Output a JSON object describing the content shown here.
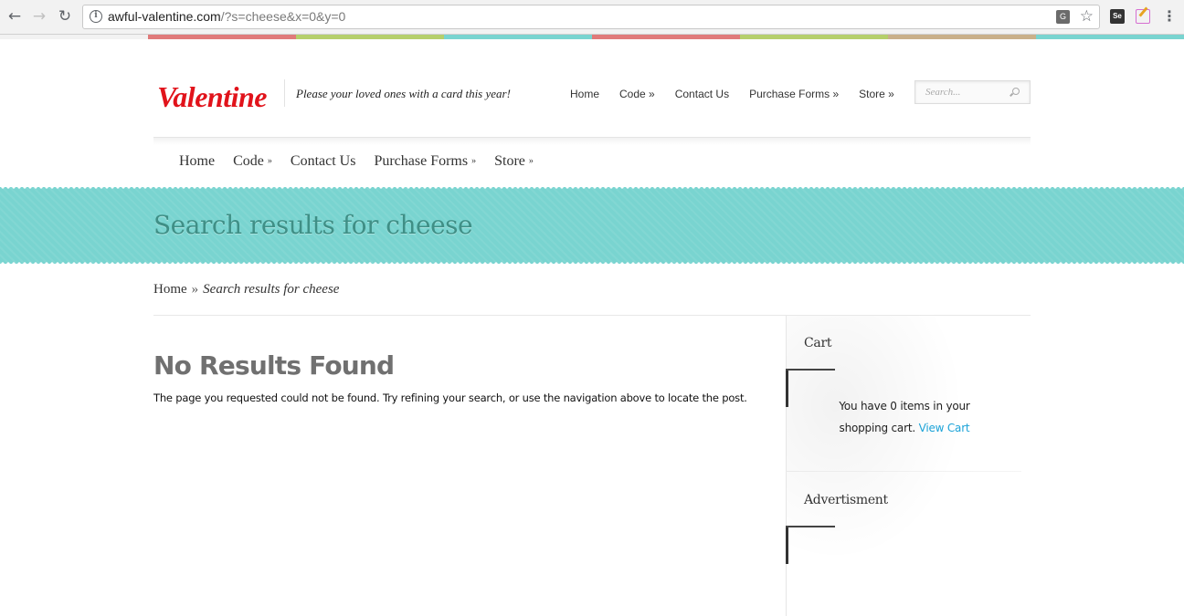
{
  "browser": {
    "url_host": "awful-valentine.com",
    "url_rest": "/?s=cheese&x=0&y=0",
    "extensions": {
      "se_label": "Se"
    }
  },
  "colors": {
    "strip": [
      "#f2f2f2",
      "#e07a7a",
      "#b5cf6b",
      "#79d4d0",
      "#e07a7a",
      "#b5cf6b",
      "#c9b08a",
      "#79d4d0"
    ],
    "accent_teal": "#79d4d0",
    "logo_red": "#e1131b",
    "link_blue": "#1ca3d8"
  },
  "header": {
    "logo": "Valentine",
    "tagline": "Please your loved ones with a card this year!",
    "top_nav": [
      "Home",
      "Code »",
      "Contact Us",
      "Purchase Forms »",
      "Store »"
    ],
    "search_placeholder": "Search..."
  },
  "main_nav": {
    "items": [
      {
        "label": "Home",
        "has_submenu": false
      },
      {
        "label": "Code",
        "has_submenu": true
      },
      {
        "label": "Contact Us",
        "has_submenu": false
      },
      {
        "label": "Purchase Forms",
        "has_submenu": true
      },
      {
        "label": "Store",
        "has_submenu": true
      }
    ],
    "arrow": "»"
  },
  "banner": {
    "title": "Search results for cheese"
  },
  "breadcrumb": {
    "home": "Home",
    "separator": "»",
    "current": "Search results for cheese"
  },
  "content": {
    "heading": "No Results Found",
    "text": "The page you requested could not be found. Try refining your search, or use the navigation above to locate the post."
  },
  "sidebar": {
    "cart_title": "Cart",
    "cart_text": "You have 0 items in your shopping cart.",
    "cart_link": "View Cart",
    "ad_title": "Advertisment"
  }
}
